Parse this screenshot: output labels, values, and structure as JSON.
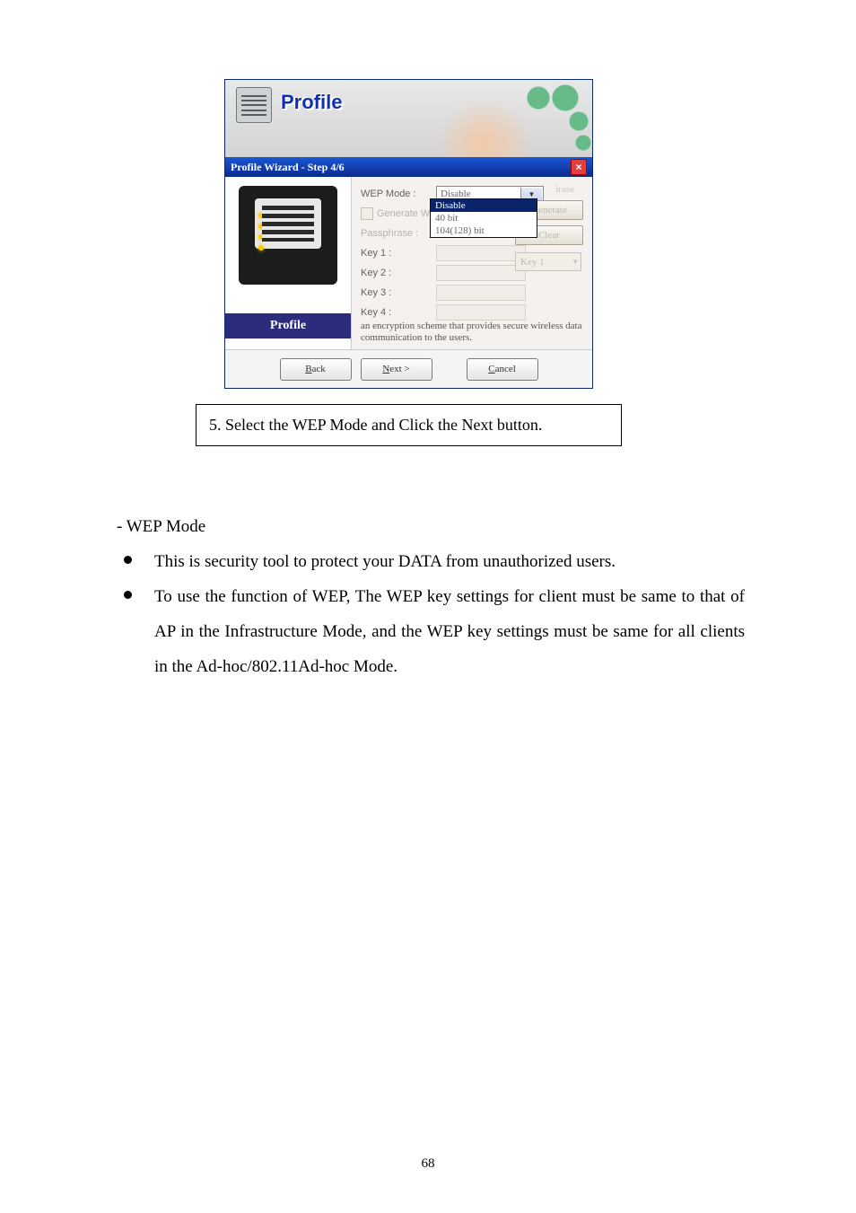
{
  "dialog": {
    "banner_title": "Profile",
    "step_title": "Profile Wizard - Step 4/6",
    "left_label": "Profile",
    "labels": {
      "wep_mode": "WEP Mode :",
      "generate": "Generate W",
      "passphrase": "Passphrase :",
      "key1": "Key 1 :",
      "key2": "Key 2 :",
      "key3": "Key 3 :",
      "key4": "Key 4 :",
      "rase": "irase"
    },
    "wep_sel_value": "Disable",
    "wep_options": [
      "Disable",
      "40 bit",
      "104(128) bit"
    ],
    "buttons": {
      "generate": "Generate",
      "clear": "Clear",
      "keysel": "Key 1"
    },
    "description": "an encryption scheme that provides secure wireless data communication to the users.",
    "nav": {
      "back": "Back",
      "next": "Next >",
      "cancel": "Cancel"
    },
    "accel": {
      "back": "B",
      "next": "N",
      "cancel": "C"
    }
  },
  "caption": "5. Select the WEP Mode and Click the Next button.",
  "text": {
    "heading": "- WEP Mode",
    "bullet1": "This is security tool to protect your DATA from unauthorized users.",
    "bullet2": "To use the function of WEP, The WEP key settings for client must be same to that of AP in the Infrastructure Mode, and the WEP key settings must be same for all clients in the Ad-hoc/802.11Ad-hoc Mode."
  },
  "page_number": "68"
}
